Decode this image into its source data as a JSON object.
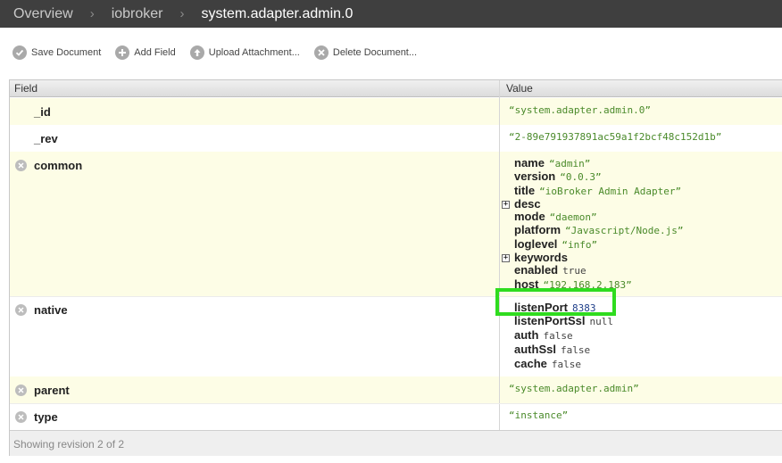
{
  "breadcrumb": [
    "Overview",
    "iobroker",
    "system.adapter.admin.0"
  ],
  "toolbar": {
    "save": "Save Document",
    "add": "Add Field",
    "upload": "Upload Attachment...",
    "delete": "Delete Document..."
  },
  "table": {
    "col_field": "Field",
    "col_value": "Value"
  },
  "rows": {
    "id": {
      "field": "_id",
      "value": "“system.adapter.admin.0”"
    },
    "rev": {
      "field": "_rev",
      "value": "“2-89e791937891ac59a1f2bcf48c152d1b”"
    },
    "common": {
      "field": "common",
      "entries": [
        {
          "key": "name",
          "value": "“admin”"
        },
        {
          "key": "version",
          "value": "“0.0.3”"
        },
        {
          "key": "title",
          "value": "“ioBroker Admin Adapter”"
        },
        {
          "key": "desc",
          "value": ""
        },
        {
          "key": "mode",
          "value": "“daemon”"
        },
        {
          "key": "platform",
          "value": "“Javascript/Node.js”"
        },
        {
          "key": "loglevel",
          "value": "“info”"
        },
        {
          "key": "keywords",
          "value": ""
        },
        {
          "key": "enabled",
          "value": "true"
        },
        {
          "key": "host",
          "value": "“192.168.2.183”"
        }
      ]
    },
    "native": {
      "field": "native",
      "entries": [
        {
          "key": "listenPort",
          "value": "8383"
        },
        {
          "key": "listenPortSsl",
          "value": "null"
        },
        {
          "key": "auth",
          "value": "false"
        },
        {
          "key": "authSsl",
          "value": "false"
        },
        {
          "key": "cache",
          "value": "false"
        }
      ]
    },
    "parent": {
      "field": "parent",
      "value": "“system.adapter.admin”"
    },
    "type": {
      "field": "type",
      "value": "“instance”"
    }
  },
  "footer": "Showing revision 2 of 2",
  "colors": {
    "topbar": "#3f3f3f",
    "row_yellow": "#fdfde6",
    "string_value": "#4a8a2a",
    "number_value": "#1f3f8a",
    "highlight": "#2fdc1f"
  }
}
